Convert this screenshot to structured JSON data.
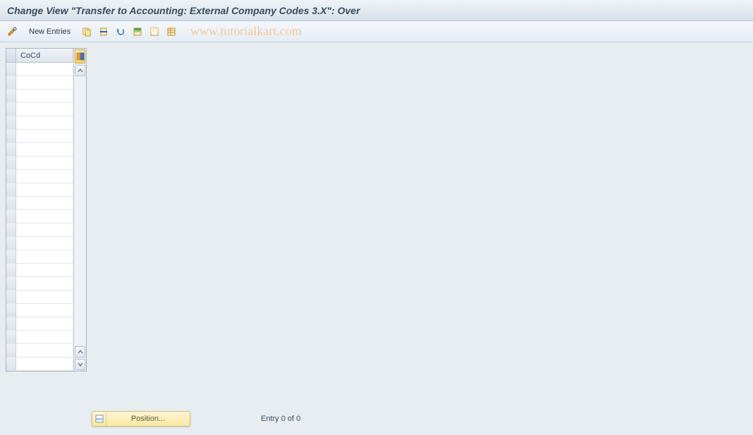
{
  "header": {
    "title": "Change View \"Transfer to Accounting: External Company Codes 3.X\": Over"
  },
  "toolbar": {
    "new_entries_label": "New Entries",
    "watermark": "www.tutorialkart.com"
  },
  "table": {
    "column_header": "CoCd",
    "row_count": 23
  },
  "footer": {
    "position_label": "Position...",
    "status_text": "Entry 0 of 0"
  }
}
